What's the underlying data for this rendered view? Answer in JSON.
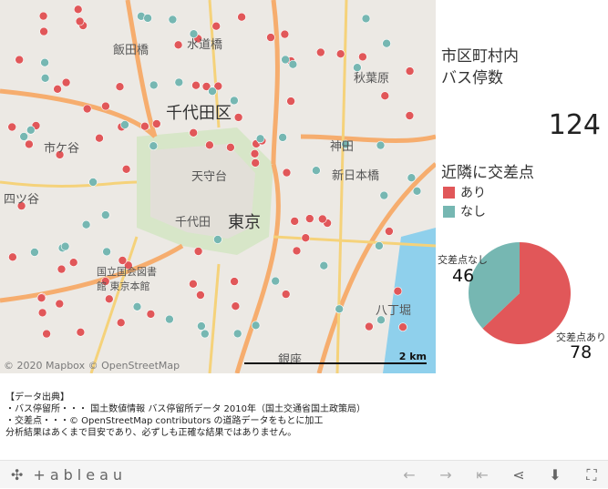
{
  "map": {
    "labels": [
      "千代田区",
      "東京",
      "千代田",
      "天守台",
      "神田",
      "秋葉原",
      "水道橋",
      "飯田橋",
      "新日本橋",
      "八丁堀",
      "銀座",
      "四ツ谷",
      "市ケ谷",
      "国立国会図書館 東京本館"
    ],
    "attribution": "© 2020 Mapbox © OpenStreetMap",
    "scale": "2 km"
  },
  "side": {
    "title_line1": "市区町村内",
    "title_line2": "バス停数",
    "count": "124",
    "legend_title": "近隣に交差点",
    "legend": [
      {
        "label": "あり",
        "color": "#e15759"
      },
      {
        "label": "なし",
        "color": "#76b7b2"
      }
    ]
  },
  "chart_data": {
    "type": "pie",
    "categories": [
      "交差点あり",
      "交差点なし"
    ],
    "values": [
      78,
      46
    ],
    "colors": [
      "#e15759",
      "#76b7b2"
    ]
  },
  "notes": [
    "【データ出典】",
    "・バス停留所・・・ 国土数値情報 バス停留所データ 2010年（国土交通省国土政策局）",
    "・交差点・・・© OpenStreetMap contributors の道路データをもとに加工",
    "分析結果はあくまで目安であり、必ずしも正確な結果ではありません。"
  ],
  "footer": {
    "logo": "+ableau",
    "icons": [
      "back-icon",
      "forward-icon",
      "first-icon",
      "share-icon",
      "download-icon",
      "fullscreen-icon"
    ]
  }
}
